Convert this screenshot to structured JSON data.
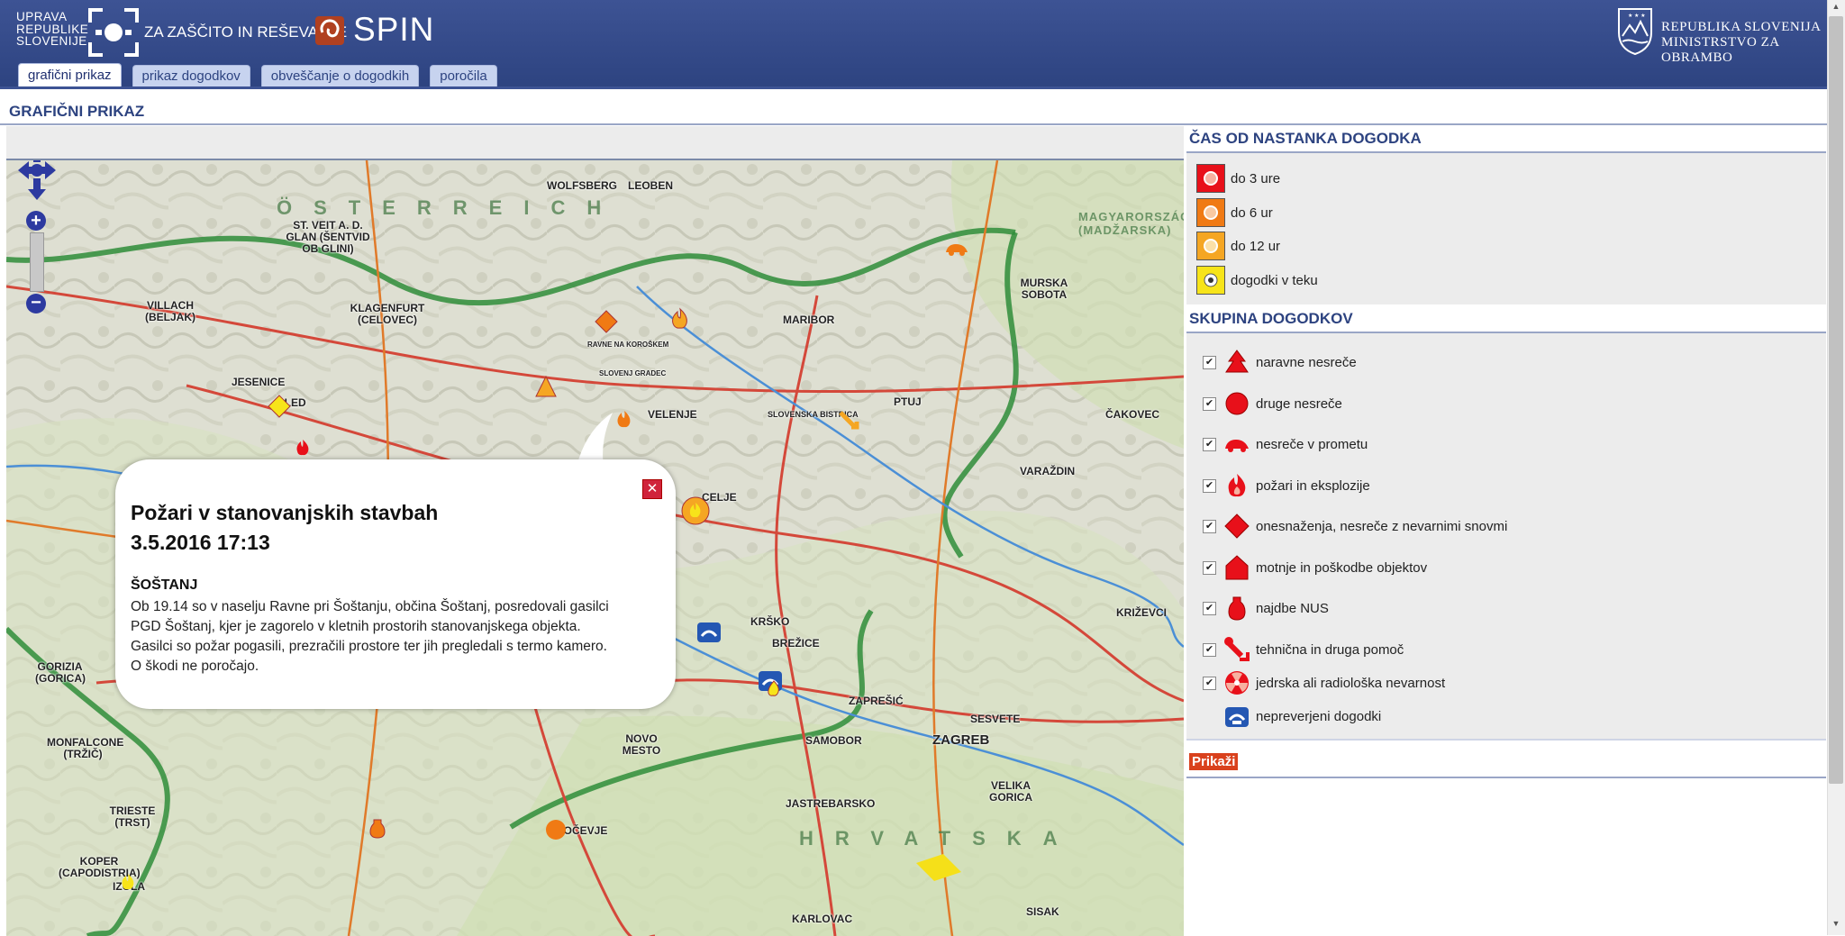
{
  "header": {
    "logo_lines": [
      "UPRAVA",
      "REPUBLIKE",
      "SLOVENIJE"
    ],
    "logo_subtitle": "ZA ZAŠČITO IN REŠEVANJE",
    "app_name": "SPIN",
    "ministry_line1": "REPUBLIKA SLOVENIJA",
    "ministry_line2": "MINISTRSTVO ZA OBRAMBO",
    "brand_color": "#2d4380"
  },
  "tabs": [
    {
      "label": "grafični prikaz",
      "active": true
    },
    {
      "label": "prikaz dogodkov",
      "active": false
    },
    {
      "label": "obveščanje o dogodkih",
      "active": false
    },
    {
      "label": "poročila",
      "active": false
    }
  ],
  "page_title": "GRAFIČNI PRIKAZ",
  "map": {
    "labels": [
      "WOLFSBERG",
      "LEOBEN",
      "ST. VEIT A. D. GLAN (ŠENTVID OB GLINI)",
      "VILLACH (BELJAK)",
      "KLAGENFURT (CELOVEC)",
      "MARIBOR",
      "RAVNE NA KOROŠKEM",
      "SLOVENJ GRADEC",
      "JESENICE",
      "BLED",
      "VELENJE",
      "SLOVENSKA BISTRICA",
      "PTUJ",
      "MURSKA SOBOTA",
      "ČAKOVEC",
      "VARAŽDIN",
      "CELJE",
      "KRŠKO",
      "BREŽICE",
      "ZAPREŠIĆ",
      "ZAGREB",
      "SESVETE",
      "SAMOBOR",
      "NOVO MESTO",
      "KOČEVJE",
      "TRIESTE (TRST)",
      "KOPER (CAPODISTRIA)",
      "IZOLA",
      "KARLOVAC",
      "VELIKA GORICA",
      "SISAK",
      "KRIŽEVCI",
      "JASTREBARSKO",
      "MONFALCONE (TRŽIČ)",
      "GORIZIA (GORICA)"
    ],
    "regions": [
      "ÖSTERREICH",
      "HRVATSKA",
      "MAGYARORSZÁG (MADŽARSKA)"
    ]
  },
  "popup": {
    "title_line1": "Požari v stanovanjskih stavbah",
    "title_line2": "3.5.2016 17:13",
    "place": "ŠOŠTANJ",
    "body": "Ob 19.14 so v naselju Ravne pri Šoštanju, občina Šoštanj, posredovali gasilci PGD Šoštanj, kjer je zagorelo v kletnih prostorih stanovanjskega objekta. Gasilci so požar pogasili, prezračili prostore ter jih pregledali s termo kamero. O škodi ne poročajo.",
    "close_icon": "close-icon"
  },
  "panel": {
    "time_title": "ČAS OD NASTANKA DOGODKA",
    "time_legend": [
      {
        "label": "do 3 ure",
        "color": "#e8101a"
      },
      {
        "label": "do 6 ur",
        "color": "#f07a14"
      },
      {
        "label": "do 12 ur",
        "color": "#f5a623"
      },
      {
        "label": "dogodki v teku",
        "color": "#f7e41a"
      }
    ],
    "group_title": "SKUPINA DOGODKOV",
    "groups": [
      {
        "label": "naravne nesreče",
        "checked": true,
        "icon": "tree-icon"
      },
      {
        "label": "druge nesreče",
        "checked": true,
        "icon": "circle-icon"
      },
      {
        "label": "nesreče v prometu",
        "checked": true,
        "icon": "car-icon"
      },
      {
        "label": "požari in eksplozije",
        "checked": true,
        "icon": "fire-icon"
      },
      {
        "label": "onesnaženja, nesreče z nevarnimi snovmi",
        "checked": true,
        "icon": "diamond-icon"
      },
      {
        "label": "motnje in poškodbe objektov",
        "checked": true,
        "icon": "house-icon"
      },
      {
        "label": "najdbe NUS",
        "checked": true,
        "icon": "grenade-icon"
      },
      {
        "label": "tehnična in druga pomoč",
        "checked": true,
        "icon": "wrench-icon"
      },
      {
        "label": "jedrska ali radiološka nevarnost",
        "checked": true,
        "icon": "radiation-icon"
      },
      {
        "label": "nepreverjeni dogodki",
        "checked": false,
        "icon": "phone-icon"
      }
    ],
    "show_button": "Prikaži",
    "check_mark": "✔"
  }
}
